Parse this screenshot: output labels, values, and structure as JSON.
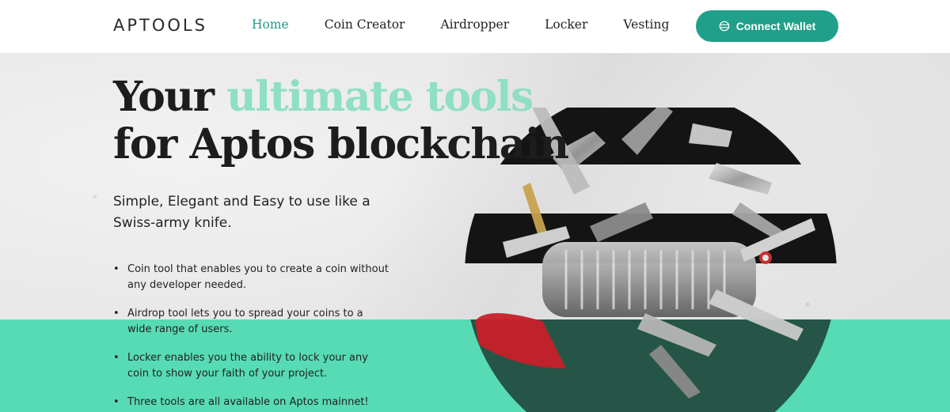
{
  "header": {
    "logo": "APTOOLS",
    "nav": [
      {
        "label": "Home",
        "active": true
      },
      {
        "label": "Coin Creator",
        "active": false
      },
      {
        "label": "Airdropper",
        "active": false
      },
      {
        "label": "Locker",
        "active": false
      },
      {
        "label": "Vesting",
        "active": false
      }
    ],
    "connect_button": {
      "label": "Connect Wallet",
      "icon": "globe-icon"
    }
  },
  "hero": {
    "headline_part1": "Your ",
    "headline_accent": "ultimate tools",
    "headline_line2": "for Aptos blockchain",
    "subtitle": "Simple, Elegant and Easy to use like a Swiss-army knife.",
    "features": [
      "Coin tool that enables you to create a coin without any developer needed.",
      "Airdrop tool lets you to spread your coins to a wide range of users.",
      "Locker enables you the ability to lock your any coin to show your faith of your project.",
      "Three tools are all available on Aptos mainnet!"
    ],
    "illustration": "swiss-army-knife-image"
  },
  "colors": {
    "brand": "#20a08a",
    "accent": "#8fdfc4",
    "band": "#57dbb4",
    "active_nav": "#1f9a87"
  }
}
